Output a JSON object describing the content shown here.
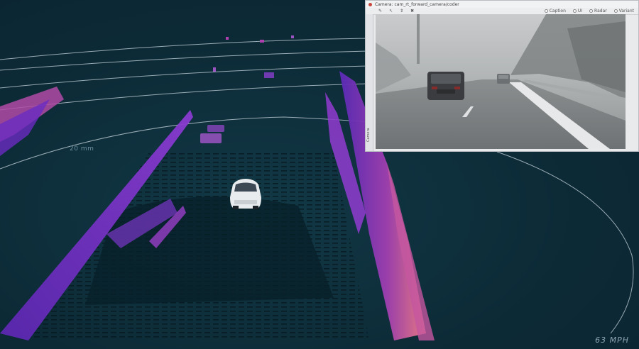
{
  "viewer": {
    "range_ring_label": "20 mm",
    "speed": "63 MPH"
  },
  "camera_panel": {
    "title": "Camera: cam_rt_forward_camera/coder",
    "toolbar_options": [
      "Caption",
      "UI",
      "Radar",
      "Variant"
    ],
    "side_tab_label": "Camera"
  },
  "colors": {
    "background": "#0e2e3a",
    "ring": "#c9d6dd",
    "point_low": "#6b2cc9",
    "point_mid": "#a640a8",
    "point_high": "#f07d86"
  },
  "icons": [
    "pin-icon",
    "cursor-icon",
    "bookmark-icon",
    "info-icon",
    "close-icon"
  ]
}
